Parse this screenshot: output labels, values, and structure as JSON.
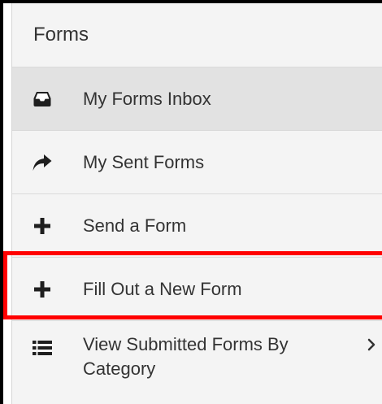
{
  "panel": {
    "title": "Forms"
  },
  "menu": {
    "items": [
      {
        "label": "My Forms Inbox",
        "icon": "inbox-icon",
        "active": true
      },
      {
        "label": "My Sent Forms",
        "icon": "share-arrow-icon",
        "active": false
      },
      {
        "label": "Send a Form",
        "icon": "plus-icon",
        "active": false
      },
      {
        "label": "Fill Out a New Form",
        "icon": "plus-icon",
        "active": false,
        "highlighted": true
      },
      {
        "label": "View Submitted Forms By Category",
        "icon": "list-icon",
        "active": false,
        "has_submenu": true
      }
    ]
  },
  "colors": {
    "panel_background": "#f4f4f4",
    "active_background": "#e2e2e2",
    "text": "#333333",
    "icon": "#1f1f1f",
    "highlight_border": "#ff0000",
    "frame_border": "#000000"
  }
}
